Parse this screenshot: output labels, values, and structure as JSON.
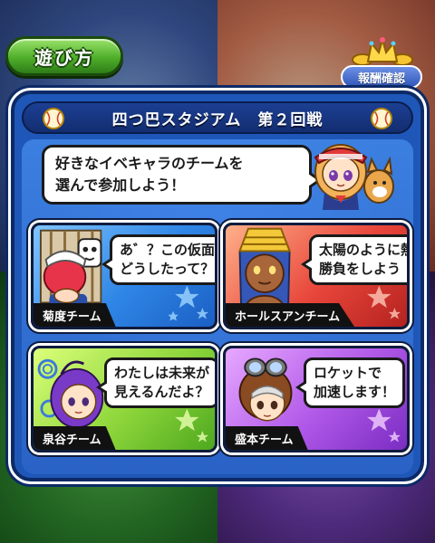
{
  "top": {
    "howto_label": "遊び方",
    "reward_label": "報酬確認"
  },
  "panel": {
    "title": "四つ巴スタジアム　第２回戦",
    "intro_line1": "好きなイベキャラのチームを",
    "intro_line2": "選んで参加しよう！"
  },
  "teams": [
    {
      "name": "菊度チーム",
      "line1": "あ゛？この仮面が",
      "line2": "どうしたって？",
      "color": "#2f86e6"
    },
    {
      "name": "ホールスアンチーム",
      "line1": "太陽のように熱い",
      "line2": "勝負をしよう",
      "color": "#e8463a"
    },
    {
      "name": "泉谷チーム",
      "line1": "わたしは未来が",
      "line2": "見えるんだよ？",
      "color": "#8ed63b"
    },
    {
      "name": "盛本チーム",
      "line1": "ロケットで",
      "line2": "加速します！",
      "color": "#b058e8"
    }
  ],
  "colors": {
    "panel_blue": "#1f57b8",
    "header_navy": "#132d70",
    "howto_green": "#4fae2a"
  }
}
